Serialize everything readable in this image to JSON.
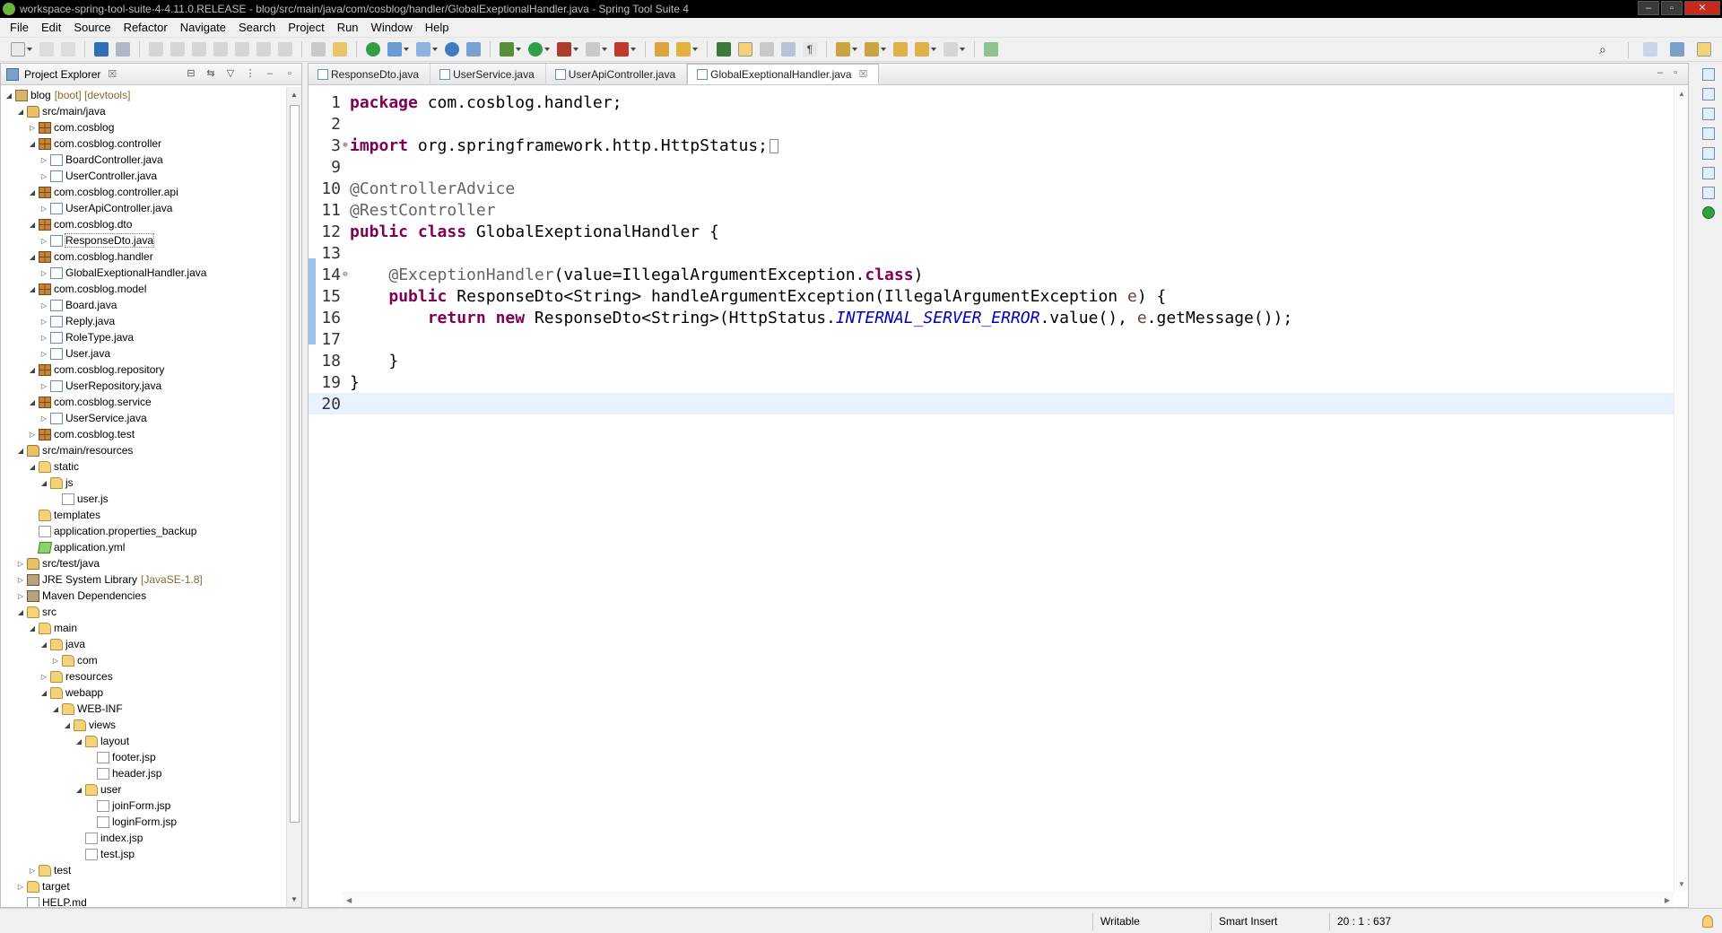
{
  "window": {
    "title": "workspace-spring-tool-suite-4-4.11.0.RELEASE - blog/src/main/java/com/cosblog/handler/GlobalExeptionalHandler.java - Spring Tool Suite 4"
  },
  "menu": [
    "File",
    "Edit",
    "Source",
    "Refactor",
    "Navigate",
    "Search",
    "Project",
    "Run",
    "Window",
    "Help"
  ],
  "explorer": {
    "title": "Project Explorer",
    "close": "☒",
    "tree": [
      {
        "label": "blog",
        "deco": "[boot] [devtools]",
        "icon": "project-icon",
        "depth": 0,
        "twisty": "open"
      },
      {
        "label": "src/main/java",
        "icon": "source-folder-icon",
        "depth": 1,
        "twisty": "open"
      },
      {
        "label": "com.cosblog",
        "icon": "package-icon",
        "depth": 2,
        "twisty": "closed"
      },
      {
        "label": "com.cosblog.controller",
        "icon": "package-icon",
        "depth": 2,
        "twisty": "open"
      },
      {
        "label": "BoardController.java",
        "icon": "java-file-icon",
        "depth": 3,
        "twisty": "closed"
      },
      {
        "label": "UserController.java",
        "icon": "java-file-icon",
        "depth": 3,
        "twisty": "closed"
      },
      {
        "label": "com.cosblog.controller.api",
        "icon": "package-icon",
        "depth": 2,
        "twisty": "open"
      },
      {
        "label": "UserApiController.java",
        "icon": "java-file-icon",
        "depth": 3,
        "twisty": "closed"
      },
      {
        "label": "com.cosblog.dto",
        "icon": "package-icon",
        "depth": 2,
        "twisty": "open"
      },
      {
        "label": "ResponseDto.java",
        "icon": "java-file-icon",
        "depth": 3,
        "twisty": "closed",
        "selected": true
      },
      {
        "label": "com.cosblog.handler",
        "icon": "package-icon",
        "depth": 2,
        "twisty": "open"
      },
      {
        "label": "GlobalExeptionalHandler.java",
        "icon": "java-file-icon",
        "depth": 3,
        "twisty": "closed"
      },
      {
        "label": "com.cosblog.model",
        "icon": "package-icon",
        "depth": 2,
        "twisty": "open"
      },
      {
        "label": "Board.java",
        "icon": "java-file-icon",
        "depth": 3,
        "twisty": "closed"
      },
      {
        "label": "Reply.java",
        "icon": "java-file-icon",
        "depth": 3,
        "twisty": "closed"
      },
      {
        "label": "RoleType.java",
        "icon": "java-file-icon",
        "depth": 3,
        "twisty": "closed"
      },
      {
        "label": "User.java",
        "icon": "java-file-icon",
        "depth": 3,
        "twisty": "closed"
      },
      {
        "label": "com.cosblog.repository",
        "icon": "package-icon",
        "depth": 2,
        "twisty": "open"
      },
      {
        "label": "UserRepository.java",
        "icon": "java-file-icon",
        "depth": 3,
        "twisty": "closed"
      },
      {
        "label": "com.cosblog.service",
        "icon": "package-icon",
        "depth": 2,
        "twisty": "open"
      },
      {
        "label": "UserService.java",
        "icon": "java-file-icon",
        "depth": 3,
        "twisty": "closed"
      },
      {
        "label": "com.cosblog.test",
        "icon": "package-icon",
        "depth": 2,
        "twisty": "closed"
      },
      {
        "label": "src/main/resources",
        "icon": "source-folder-icon",
        "depth": 1,
        "twisty": "open"
      },
      {
        "label": "static",
        "icon": "folder-icon",
        "depth": 2,
        "twisty": "open"
      },
      {
        "label": "js",
        "icon": "folder-icon",
        "depth": 3,
        "twisty": "open"
      },
      {
        "label": "user.js",
        "icon": "file-icon",
        "depth": 4,
        "twisty": "none"
      },
      {
        "label": "templates",
        "icon": "folder-icon",
        "depth": 2,
        "twisty": "none"
      },
      {
        "label": "application.properties_backup",
        "icon": "file-icon",
        "depth": 2,
        "twisty": "none"
      },
      {
        "label": "application.yml",
        "icon": "yml-file-icon",
        "depth": 2,
        "twisty": "none"
      },
      {
        "label": "src/test/java",
        "icon": "source-folder-icon",
        "depth": 1,
        "twisty": "closed"
      },
      {
        "label": "JRE System Library",
        "deco": "[JavaSE-1.8]",
        "icon": "library-icon",
        "depth": 1,
        "twisty": "closed"
      },
      {
        "label": "Maven Dependencies",
        "icon": "library-icon",
        "depth": 1,
        "twisty": "closed"
      },
      {
        "label": "src",
        "icon": "folder-icon",
        "depth": 1,
        "twisty": "open"
      },
      {
        "label": "main",
        "icon": "folder-icon",
        "depth": 2,
        "twisty": "open"
      },
      {
        "label": "java",
        "icon": "folder-icon",
        "depth": 3,
        "twisty": "open"
      },
      {
        "label": "com",
        "icon": "folder-icon",
        "depth": 4,
        "twisty": "closed"
      },
      {
        "label": "resources",
        "icon": "folder-icon",
        "depth": 3,
        "twisty": "closed"
      },
      {
        "label": "webapp",
        "icon": "folder-icon",
        "depth": 3,
        "twisty": "open"
      },
      {
        "label": "WEB-INF",
        "icon": "folder-icon",
        "depth": 4,
        "twisty": "open"
      },
      {
        "label": "views",
        "icon": "folder-icon",
        "depth": 5,
        "twisty": "open"
      },
      {
        "label": "layout",
        "icon": "folder-icon",
        "depth": 6,
        "twisty": "open"
      },
      {
        "label": "footer.jsp",
        "icon": "file-icon",
        "depth": 7,
        "twisty": "none"
      },
      {
        "label": "header.jsp",
        "icon": "file-icon",
        "depth": 7,
        "twisty": "none"
      },
      {
        "label": "user",
        "icon": "folder-icon",
        "depth": 6,
        "twisty": "open"
      },
      {
        "label": "joinForm.jsp",
        "icon": "file-icon",
        "depth": 7,
        "twisty": "none"
      },
      {
        "label": "loginForm.jsp",
        "icon": "file-icon",
        "depth": 7,
        "twisty": "none"
      },
      {
        "label": "index.jsp",
        "icon": "file-icon",
        "depth": 6,
        "twisty": "none"
      },
      {
        "label": "test.jsp",
        "icon": "file-icon",
        "depth": 6,
        "twisty": "none"
      },
      {
        "label": "test",
        "icon": "folder-icon",
        "depth": 2,
        "twisty": "closed"
      },
      {
        "label": "target",
        "icon": "folder-icon",
        "depth": 1,
        "twisty": "closed"
      },
      {
        "label": "HELP.md",
        "icon": "file-icon",
        "depth": 1,
        "twisty": "none"
      }
    ]
  },
  "editor": {
    "tabs": [
      {
        "label": "ResponseDto.java",
        "active": false
      },
      {
        "label": "UserService.java",
        "active": false
      },
      {
        "label": "UserApiController.java",
        "active": false
      },
      {
        "label": "GlobalExeptionalHandler.java",
        "active": true
      }
    ],
    "tab_close": "☒",
    "lines": [
      {
        "n": "1",
        "fold": "",
        "tokens": [
          [
            "kw",
            "package"
          ],
          [
            "",
            " com.cosblog.handler;"
          ]
        ]
      },
      {
        "n": "2",
        "fold": "",
        "tokens": []
      },
      {
        "n": "3",
        "fold": "⊕",
        "tokens": [
          [
            "kw",
            "import"
          ],
          [
            "",
            " org.springframework.http.HttpStatus;"
          ]
        ],
        "collapsed": true
      },
      {
        "n": "9",
        "fold": "",
        "tokens": []
      },
      {
        "n": "10",
        "fold": "",
        "tokens": [
          [
            "ann",
            "@ControllerAdvice"
          ]
        ]
      },
      {
        "n": "11",
        "fold": "",
        "tokens": [
          [
            "ann",
            "@RestController"
          ]
        ]
      },
      {
        "n": "12",
        "fold": "",
        "tokens": [
          [
            "kw",
            "public"
          ],
          [
            "",
            " "
          ],
          [
            "kw",
            "class"
          ],
          [
            "",
            " GlobalExeptionalHandler {"
          ]
        ]
      },
      {
        "n": "13",
        "fold": "",
        "tokens": []
      },
      {
        "n": "14",
        "fold": "⊖",
        "tokens": [
          [
            "",
            "    "
          ],
          [
            "ann",
            "@ExceptionHandler"
          ],
          [
            "",
            "(value=IllegalArgumentException."
          ],
          [
            "kw",
            "class"
          ],
          [
            "",
            ")"
          ]
        ]
      },
      {
        "n": "15",
        "fold": "",
        "tokens": [
          [
            "",
            "    "
          ],
          [
            "kw",
            "public"
          ],
          [
            "",
            " ResponseDto<String> handleArgumentException(IllegalArgumentException "
          ],
          [
            "vr",
            "e"
          ],
          [
            "",
            ") {"
          ]
        ]
      },
      {
        "n": "16",
        "fold": "",
        "tokens": [
          [
            "",
            "        "
          ],
          [
            "kw",
            "return"
          ],
          [
            "",
            " "
          ],
          [
            "kw",
            "new"
          ],
          [
            "",
            " ResponseDto<String>(HttpStatus."
          ],
          [
            "cst",
            "INTERNAL_SERVER_ERROR"
          ],
          [
            "",
            ".value(), "
          ],
          [
            "vr",
            "e"
          ],
          [
            "",
            ".getMessage());"
          ]
        ]
      },
      {
        "n": "17",
        "fold": "",
        "tokens": []
      },
      {
        "n": "18",
        "fold": "",
        "tokens": [
          [
            "",
            "    }"
          ]
        ]
      },
      {
        "n": "19",
        "fold": "",
        "tokens": [
          [
            "",
            "}"
          ]
        ]
      },
      {
        "n": "20",
        "fold": "",
        "tokens": [],
        "current": true
      }
    ]
  },
  "status": {
    "mode": "Writable",
    "insert": "Smart Insert",
    "position": "20 : 1 : 637"
  },
  "colors": {
    "keyword": "#7f0055",
    "annotation": "#646464",
    "constant": "#0000c0",
    "current_line": "#e8f2fe"
  }
}
